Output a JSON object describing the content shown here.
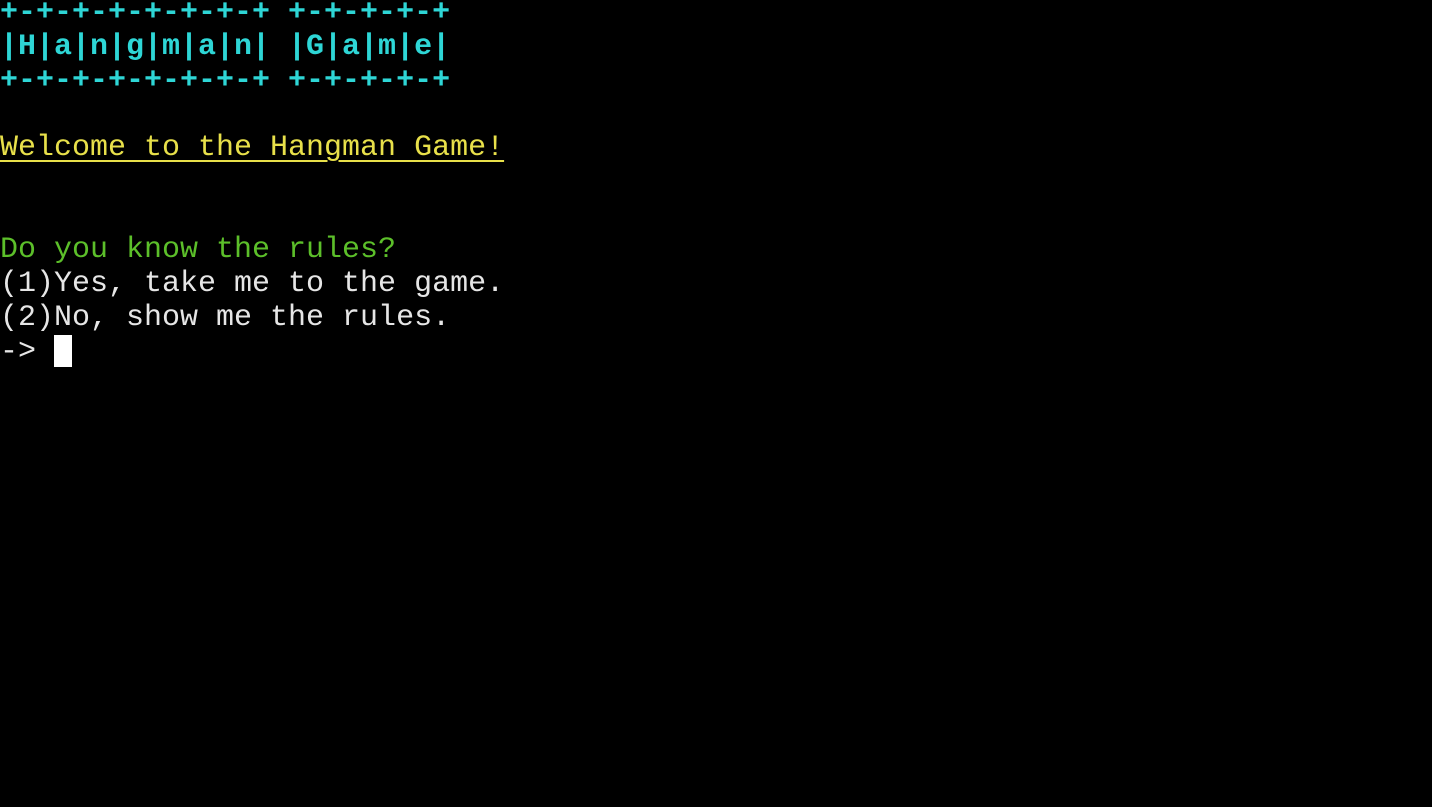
{
  "banner": {
    "top_border": "+-+-+-+-+-+-+-+ +-+-+-+-+",
    "title_row": "|H|a|n|g|m|a|n| |G|a|m|e|",
    "bottom_border": "+-+-+-+-+-+-+-+ +-+-+-+-+"
  },
  "welcome_text": "Welcome to the Hangman Game!",
  "question": "Do you know the rules?",
  "options": [
    "(1)Yes, take me to the game.",
    "(2)No, show me the rules."
  ],
  "prompt_symbol": "-> ",
  "input_value": "",
  "colors": {
    "background": "#000000",
    "banner": "#2ed6d6",
    "welcome": "#e8e04a",
    "question": "#5cbf2a",
    "text": "#e6e6e6"
  }
}
